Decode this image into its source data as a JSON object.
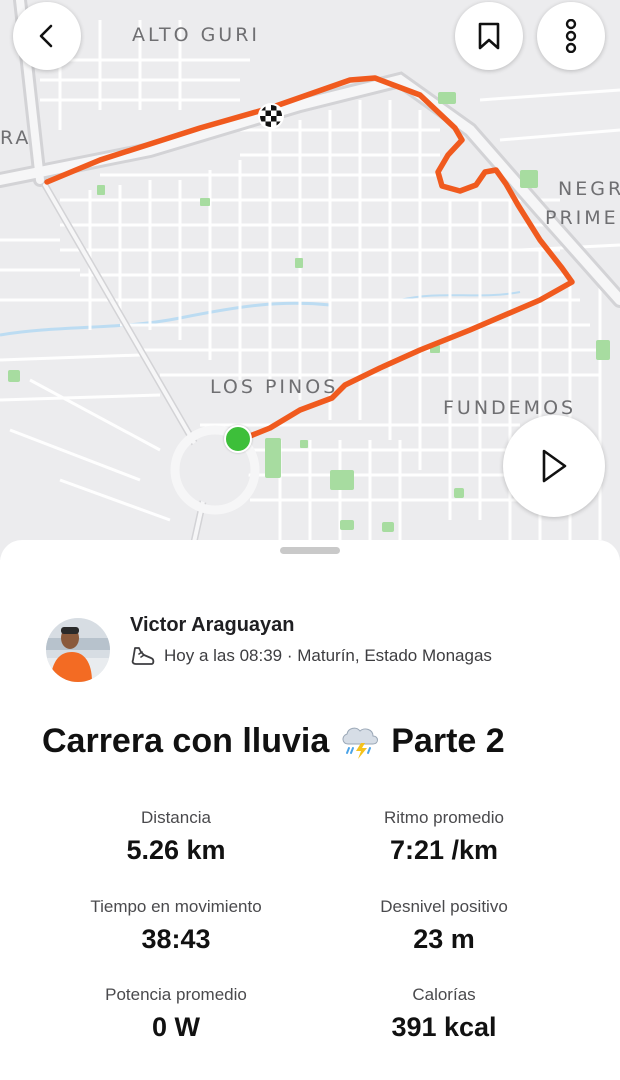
{
  "map": {
    "labels": [
      "ALTO GURI",
      "NEGR",
      "PRIME",
      "LOS PINOS",
      "FUNDEMOS",
      "RA"
    ]
  },
  "toolbar": {
    "back_icon": "chevron-left-icon",
    "bookmark_icon": "bookmark-icon",
    "more_icon": "more-vertical-icon",
    "play_icon": "play-icon"
  },
  "activity": {
    "athlete_name": "Victor Araguayan",
    "sport_icon": "running-shoe-icon",
    "meta": "Hoy a las 08:39 · Maturín, Estado Monagas",
    "title_part1": "Carrera con lluvia",
    "title_emoji": "rain-cloud-icon",
    "title_part2": "Parte 2"
  },
  "stats": [
    {
      "label": "Distancia",
      "value": "5.26 km"
    },
    {
      "label": "Ritmo promedio",
      "value": "7:21 /km"
    },
    {
      "label": "Tiempo en movimiento",
      "value": "38:43"
    },
    {
      "label": "Desnivel positivo",
      "value": "23 m"
    },
    {
      "label": "Potencia promedio",
      "value": "0 W"
    },
    {
      "label": "Calorías",
      "value": "391 kcal"
    }
  ],
  "colors": {
    "route": "#f05a1e",
    "start_marker": "#3dbf3a",
    "map_background": "#ececee",
    "park": "#a7dca0",
    "water": "#bcdcf2"
  }
}
